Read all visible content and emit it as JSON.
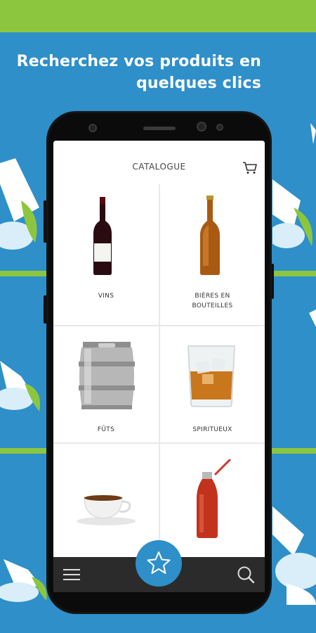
{
  "headline": {
    "line1": "Recherchez vos produits en",
    "line2": "quelques clics"
  },
  "app": {
    "title": "CATALOGUE",
    "categories": [
      {
        "label": "VINS",
        "icon": "wine-bottle-icon"
      },
      {
        "label": "BIÈRES EN",
        "label2": "BOUTEILLES",
        "icon": "beer-bottle-icon"
      },
      {
        "label": "FÛTS",
        "icon": "keg-icon"
      },
      {
        "label": "SPIRITUEUX",
        "icon": "whisky-glass-icon"
      },
      {
        "label": "",
        "icon": "coffee-cup-icon"
      },
      {
        "label": "",
        "icon": "soda-bottle-icon"
      }
    ],
    "nav": {
      "menu_icon": "menu-icon",
      "favorites_icon": "star-icon",
      "search_icon": "search-icon"
    }
  },
  "colors": {
    "brand_blue": "#2e8fc9",
    "brand_green": "#8cc63f"
  }
}
